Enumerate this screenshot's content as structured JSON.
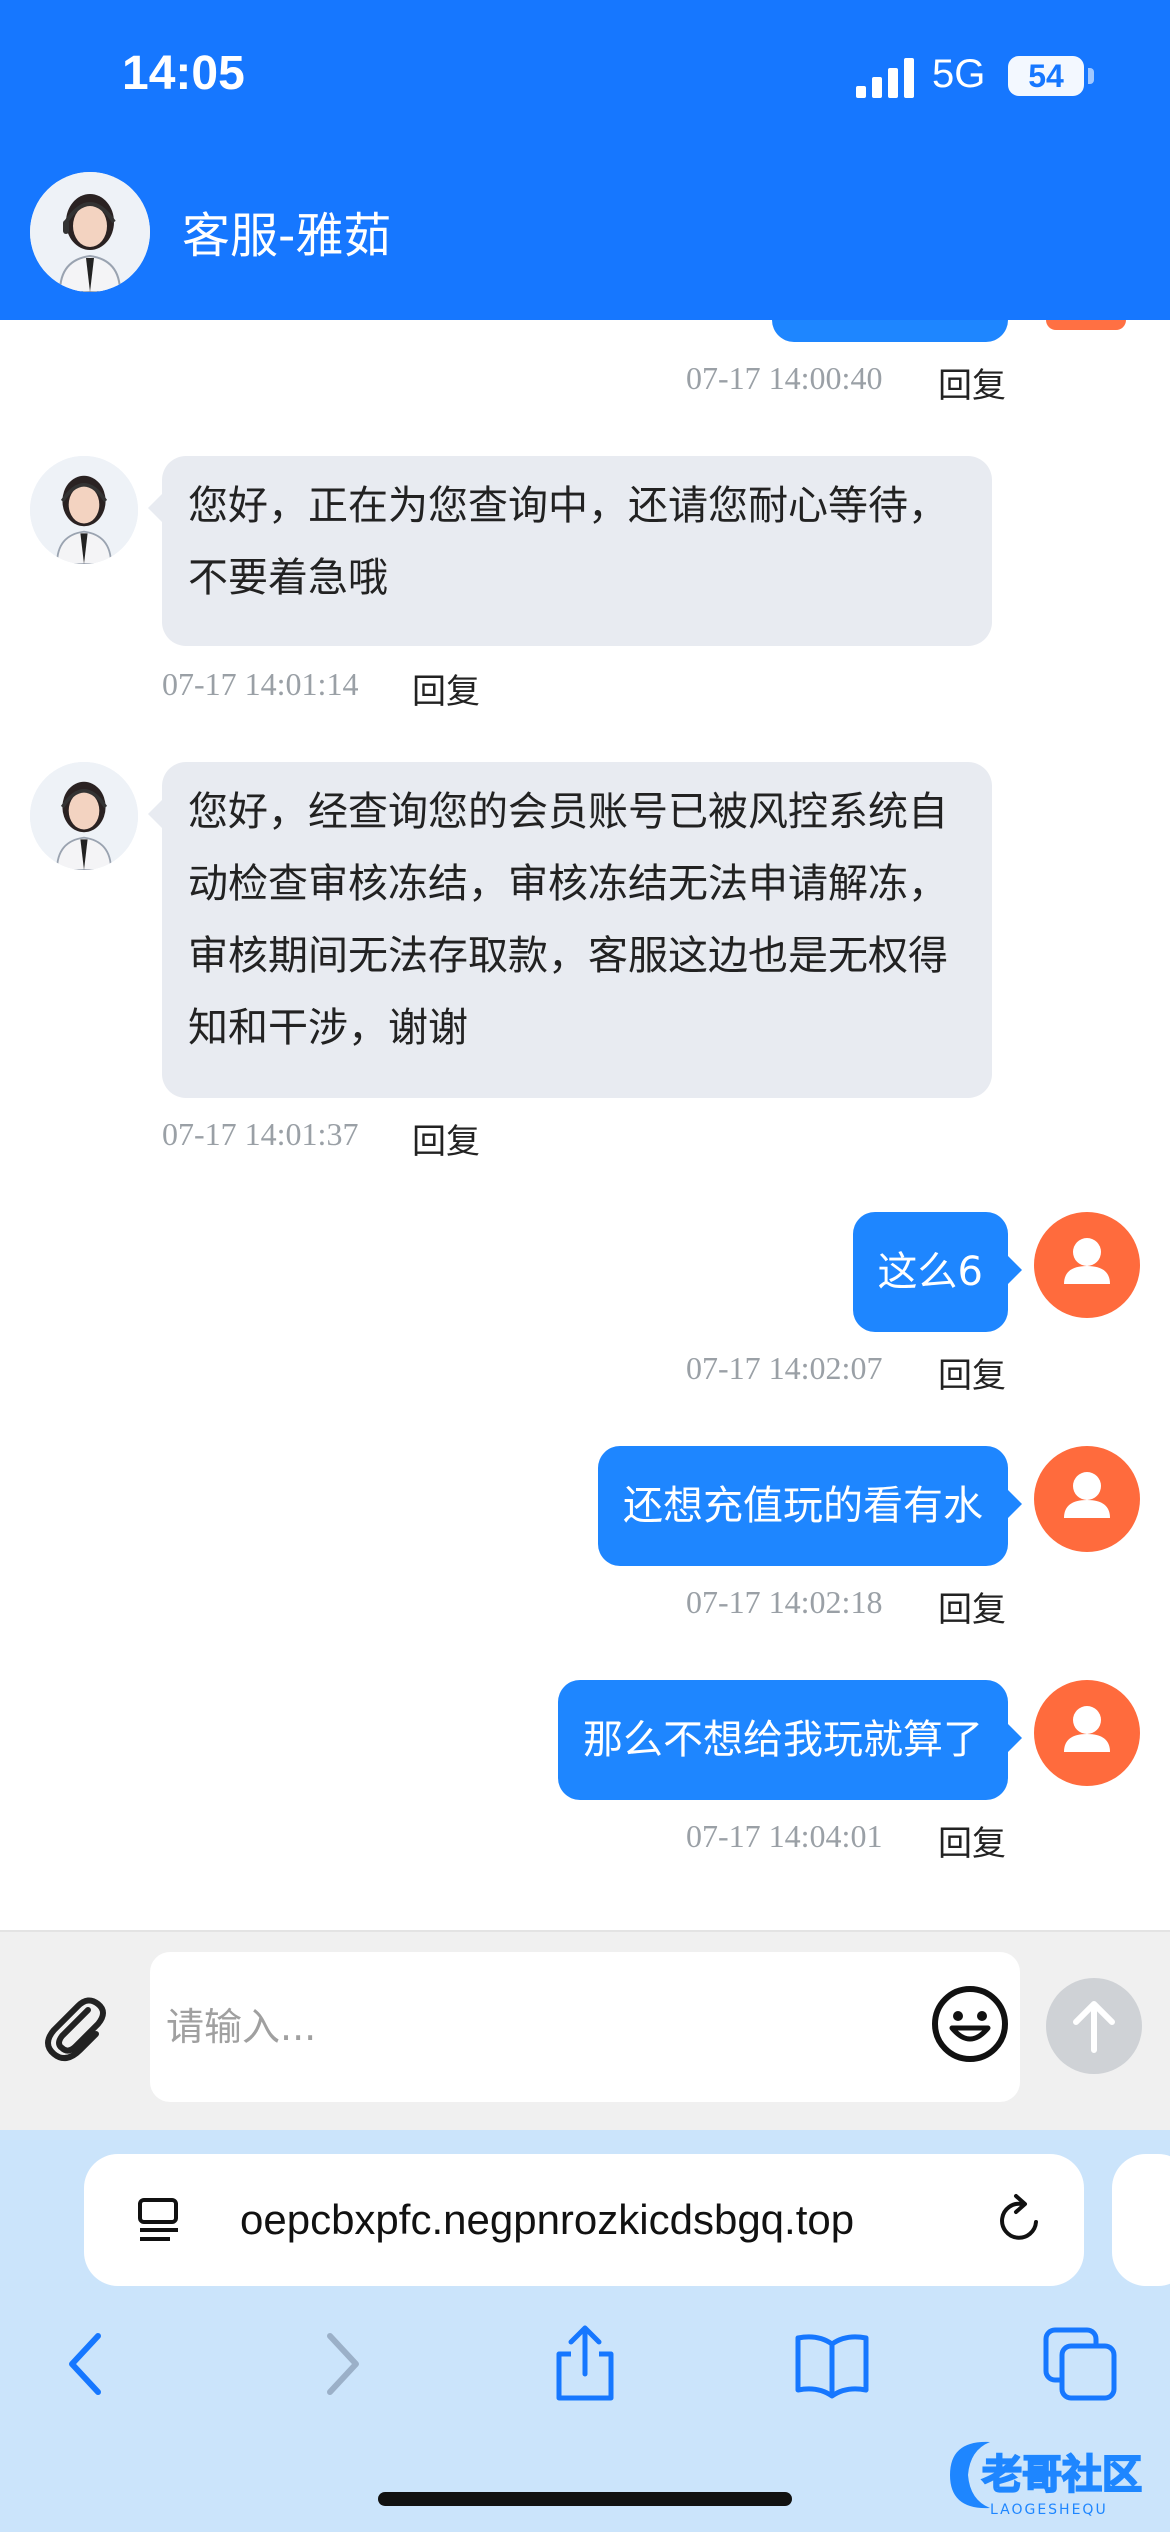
{
  "status_bar": {
    "time": "14:05",
    "network": "5G",
    "battery": "54"
  },
  "header": {
    "title": "客服-雅茹"
  },
  "messages": [
    {
      "from": "agent",
      "text": "您好，正在为您查询中，还请您耐心等待，不要着急哦",
      "time": "07-17 14:01:14",
      "reply": "回复"
    },
    {
      "from": "agent",
      "text": "您好，经查询您的会员账号已被风控系统自动检查审核冻结，审核冻结无法申请解冻，审核期间无法存取款，客服这边也是无权得知和干涉，谢谢",
      "time": "07-17 14:01:37",
      "reply": "回复"
    },
    {
      "from": "user",
      "text": "这么6",
      "time": "07-17 14:02:07",
      "reply": "回复"
    },
    {
      "from": "user",
      "text": "还想充值玩的看有水",
      "time": "07-17 14:02:18",
      "reply": "回复"
    },
    {
      "from": "user",
      "text": "那么不想给我玩就算了",
      "time": "07-17 14:04:01",
      "reply": "回复"
    }
  ],
  "partial_message": {
    "time": "07-17 14:00:40",
    "reply": "回复"
  },
  "input": {
    "placeholder": "请输入..."
  },
  "browser": {
    "url": "oepcbxpfc.negpnrozkicdsbgq.top"
  },
  "watermark": {
    "text": "老哥社区",
    "sub": "LAOGESHEQU"
  },
  "colors": {
    "header": "#1677ff",
    "user_bubble": "#1e86ff",
    "agent_bubble": "#e8ebf1",
    "user_avatar": "#ff6b3d"
  },
  "icons": [
    "signal-icon",
    "battery-icon",
    "attachment-icon",
    "emoji-icon",
    "send-arrow-icon",
    "reader-icon",
    "reload-icon",
    "back-icon",
    "forward-icon",
    "share-icon",
    "bookmarks-icon",
    "tabs-icon"
  ]
}
